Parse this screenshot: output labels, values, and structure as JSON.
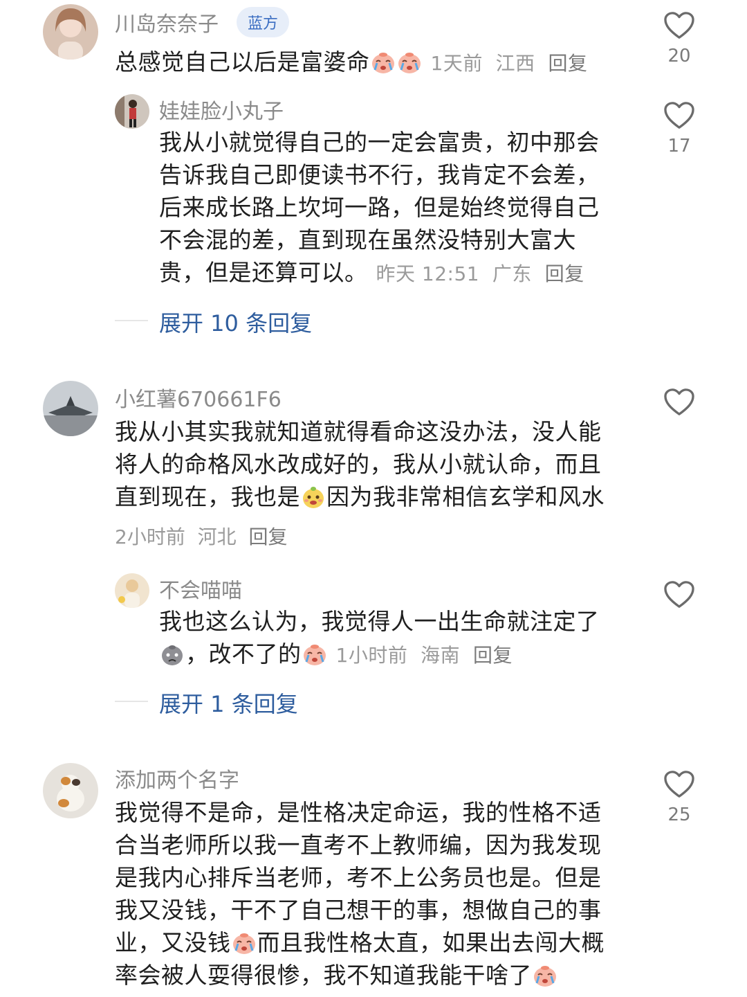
{
  "comments": [
    {
      "username": "川岛奈奈子",
      "badge": "蓝方",
      "text_before": "总感觉自己以后是富婆命",
      "emoji": "crying-face-emoji",
      "meta_time": "1天前",
      "meta_region": "江西",
      "reply_label": "回复",
      "likes": "20",
      "replies": [
        {
          "username": "娃娃脸小丸子",
          "lines": [
            "我从小就觉得自己的一定会富贵，初中那会",
            "告诉我自己即便读书不行，我肯定不会差，",
            "后来成长路上坎坷一路，但是始终觉得自己",
            "不会混的差，直到现在虽然没特别大富大"
          ],
          "last_line": "贵，但是还算可以。",
          "meta_time": "昨天 12:51",
          "meta_region": "广东",
          "reply_label": "回复",
          "likes": "17"
        }
      ],
      "expand_label": "展开 10 条回复"
    },
    {
      "username": "小红薯670661F6",
      "lines": [
        "我从小其实我就知道就得看命这没办法，没人能",
        "将人的命格风水改成好的，我从小就认命，而且"
      ],
      "line3_before": "直到现在，我也是",
      "line3_after": "因为我非常相信玄学和风水",
      "meta_time": "2小时前",
      "meta_region": "河北",
      "reply_label": "回复",
      "replies": [
        {
          "username": "不会喵喵",
          "line1": "我也这么认为，我觉得人一出生命就注定了",
          "line2_mid": "，改不了的",
          "meta_time": "1小时前",
          "meta_region": "海南",
          "reply_label": "回复"
        }
      ],
      "expand_label": "展开 1 条回复"
    },
    {
      "username": "添加两个名字",
      "lines": [
        "我觉得不是命，是性格决定命运，我的性格不适",
        "合当老师所以我一直考不上教师编，因为我发现",
        "是我内心排斥当老师，考不上公务员也是。但是",
        "我又没钱，干不了自己想干的事，想做自己的事"
      ],
      "line5_before": "业，又没钱",
      "line5_after": "而且我性格太直，如果出去闯大概",
      "line6": "率会被人耍得很惨，我不知道我能干啥了",
      "likes": "25"
    }
  ],
  "colors": {
    "text": "#1f1f1f",
    "meta": "#9a9a9a",
    "username": "#8a8a8a",
    "link": "#2e5d9e",
    "badge_bg": "#e7eef9",
    "badge_text": "#3b6ec2"
  },
  "icons": {
    "like": "heart-outline-icon",
    "emoji_crying": "crying-face-emoji",
    "emoji_yellow": "yellow-face-emoji",
    "emoji_gray": "gray-sad-face-emoji"
  }
}
